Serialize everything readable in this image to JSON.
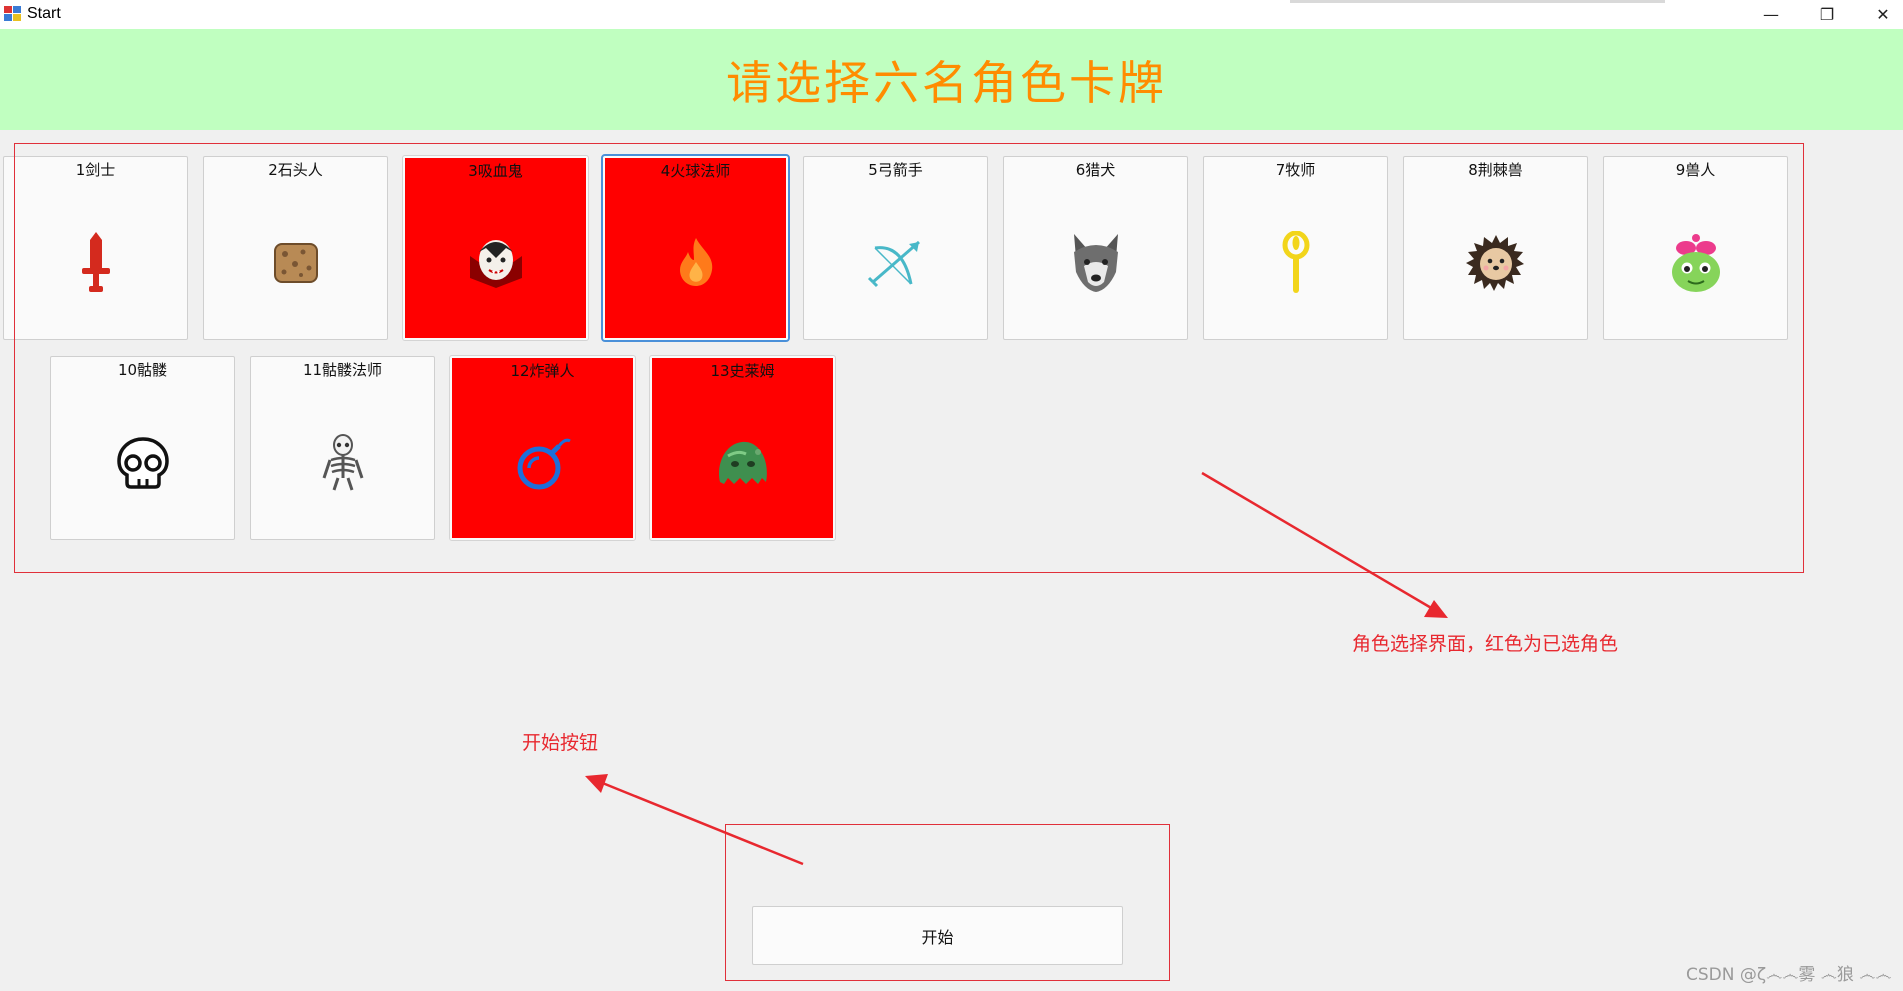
{
  "window": {
    "title": "Start",
    "minimize_glyph": "—",
    "maximize_glyph": "❐",
    "close_glyph": "✕"
  },
  "header": {
    "title": "请选择六名角色卡牌",
    "background": "#c0ffc0",
    "title_color": "#ff8c00"
  },
  "cards": [
    {
      "label": "1剑士",
      "icon": "sword-icon",
      "selected": false
    },
    {
      "label": "2石头人",
      "icon": "stone-golem-icon",
      "selected": false
    },
    {
      "label": "3吸血鬼",
      "icon": "vampire-icon",
      "selected": true
    },
    {
      "label": "4火球法师",
      "icon": "fireball-icon",
      "selected": true
    },
    {
      "label": "5弓箭手",
      "icon": "bow-arrow-icon",
      "selected": false
    },
    {
      "label": "6猎犬",
      "icon": "wolf-icon",
      "selected": false
    },
    {
      "label": "7牧师",
      "icon": "staff-icon",
      "selected": false
    },
    {
      "label": "8荆棘兽",
      "icon": "hedgehog-icon",
      "selected": false
    },
    {
      "label": "9兽人",
      "icon": "orc-icon",
      "selected": false
    },
    {
      "label": "10骷髅",
      "icon": "skull-icon",
      "selected": false
    },
    {
      "label": "11骷髅法师",
      "icon": "skeleton-icon",
      "selected": false
    },
    {
      "label": "12炸弹人",
      "icon": "bomb-icon",
      "selected": true
    },
    {
      "label": "13史莱姆",
      "icon": "slime-icon",
      "selected": true
    }
  ],
  "selected_color": "#ff0000",
  "annotations": {
    "grid_note": "角色选择界面，红色为已选角色",
    "button_note": "开始按钮",
    "color": "#e8282f"
  },
  "start_button": {
    "label": "开始"
  },
  "watermark": "CSDN @ζ෴෴雾 ෴狼 ෴෴"
}
